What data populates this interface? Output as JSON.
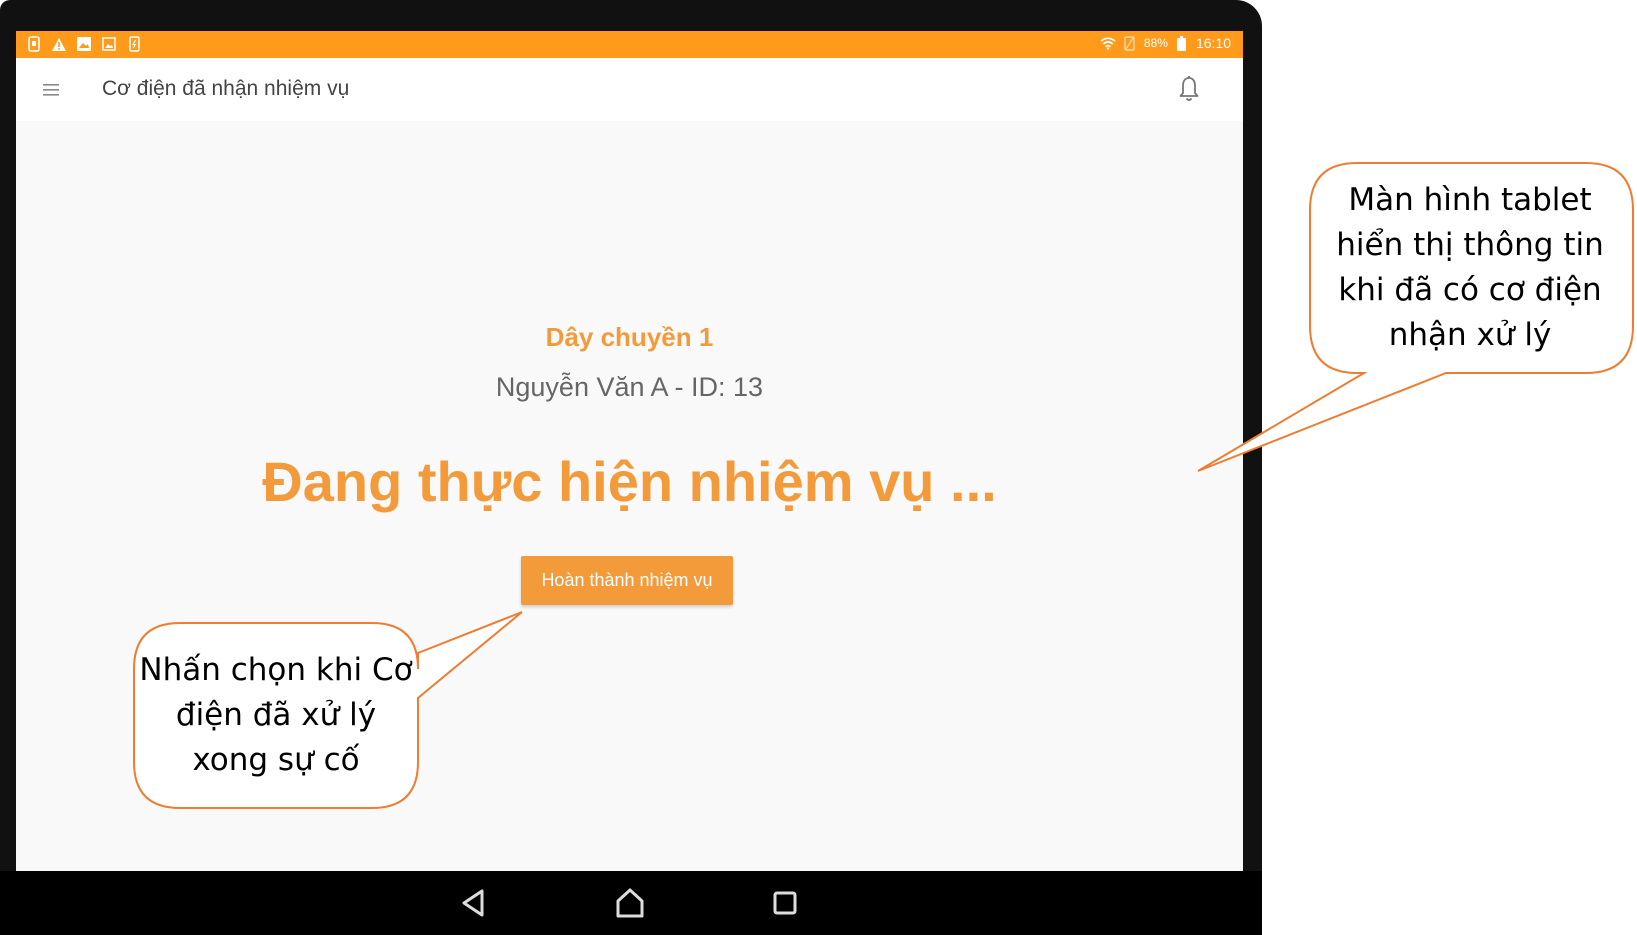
{
  "status_bar": {
    "icons_left": [
      "sim-icon",
      "warning-icon",
      "image-icon",
      "gallery-icon",
      "phone-icon"
    ],
    "icons_right": [
      "wifi-icon",
      "signal-icon",
      "battery-icon"
    ],
    "battery_percent": "88%",
    "time": "16:10",
    "background_color": "#ff9a1a"
  },
  "app_bar": {
    "title": "Cơ điện đã nhận nhiệm vụ",
    "menu_icon": "hamburger-menu-icon",
    "notification_icon": "bell-icon"
  },
  "main": {
    "line_name": "Dây chuyền 1",
    "worker_info": "Nguyễn Văn A - ID: 13",
    "status_heading": "Đang thực hiện nhiệm vụ ...",
    "complete_button_label": "Hoàn thành nhiệm vụ",
    "accent_color": "#f39a3a"
  },
  "nav_bar": {
    "buttons": [
      "back-icon",
      "home-icon",
      "recents-icon"
    ]
  },
  "callouts": {
    "screen_note": "Màn hình tablet hiển thị thông tin khi đã có cơ điện nhận xử lý",
    "button_note": "Nhấn chọn khi Cơ điện đã xử lý xong  sự cố",
    "border_color": "#ed7d31"
  }
}
